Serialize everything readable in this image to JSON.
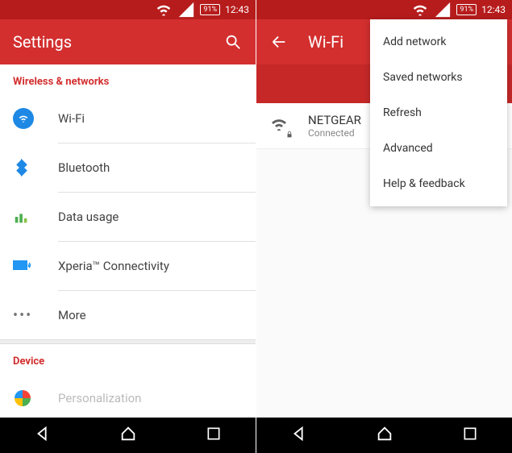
{
  "status": {
    "battery": "91%",
    "time": "12:43"
  },
  "left": {
    "title": "Settings",
    "section1": "Wireless & networks",
    "items": [
      {
        "label": "Wi-Fi"
      },
      {
        "label": "Bluetooth"
      },
      {
        "label": "Data usage"
      },
      {
        "label": "Xperia™ Connectivity"
      },
      {
        "label": "More"
      }
    ],
    "section2": "Device",
    "items2": [
      {
        "label": "Personalization"
      }
    ]
  },
  "right": {
    "title": "Wi-Fi",
    "toggle": "On",
    "network": {
      "name": "NETGEAR",
      "status": "Connected"
    },
    "menu": [
      "Add network",
      "Saved networks",
      "Refresh",
      "Advanced",
      "Help & feedback"
    ]
  }
}
